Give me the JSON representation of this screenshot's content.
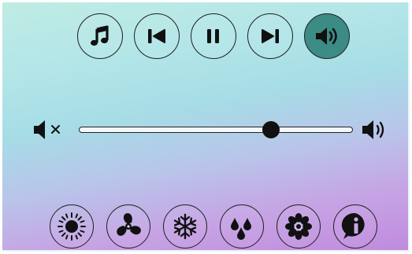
{
  "media_controls": [
    {
      "name": "music-button",
      "icon": "music-note-icon",
      "active": false
    },
    {
      "name": "previous-button",
      "icon": "skip-previous-icon",
      "active": false
    },
    {
      "name": "pause-button",
      "icon": "pause-icon",
      "active": false
    },
    {
      "name": "next-button",
      "icon": "skip-next-icon",
      "active": false
    },
    {
      "name": "volume-button",
      "icon": "speaker-icon",
      "active": true
    }
  ],
  "volume_slider": {
    "value": 0.7,
    "min_icon": "mute-icon",
    "max_icon": "volume-up-icon"
  },
  "bottom_controls": [
    {
      "name": "brightness-button",
      "icon": "sun-icon"
    },
    {
      "name": "fan-button",
      "icon": "fan-icon"
    },
    {
      "name": "cooling-button",
      "icon": "snowflake-icon"
    },
    {
      "name": "humidity-button",
      "icon": "water-drops-icon"
    },
    {
      "name": "flower-button",
      "icon": "flower-icon"
    },
    {
      "name": "info-button",
      "icon": "info-icon"
    }
  ],
  "colors": {
    "active_button": "#3d8b85",
    "icon": "#111111",
    "slider_thumb": "#111111"
  }
}
